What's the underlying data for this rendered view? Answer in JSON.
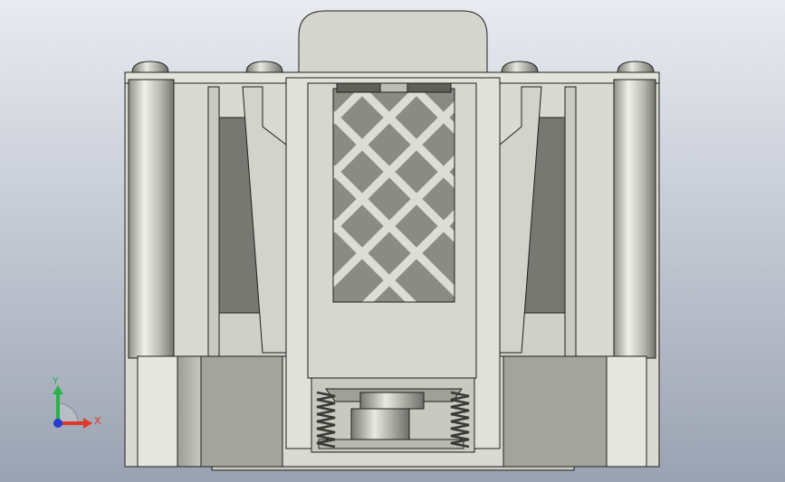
{
  "viewport": {
    "background_top": "#e9ebf0",
    "background_bottom": "#9aa2b2"
  },
  "triad": {
    "x_label": "X",
    "y_label": "Y",
    "x_color": "#e23a2a",
    "y_color": "#2bb24a",
    "z_color": "#2a3ad0"
  },
  "model": {
    "body_light": "#d7d8cf",
    "body_mid": "#b6b7ad",
    "body_dark": "#7e7f77",
    "cavity": "#6b6c66",
    "edge": "#202020"
  }
}
